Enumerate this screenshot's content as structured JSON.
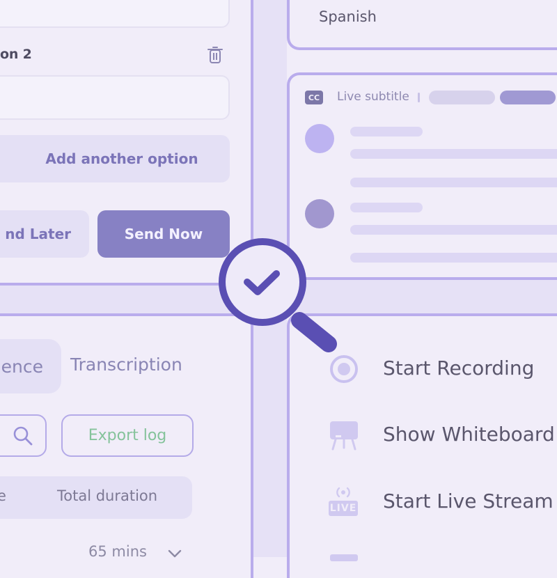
{
  "poll": {
    "option_label": "on 2",
    "add_option_label": "Add another option",
    "send_later_label": "nd Later",
    "send_now_label": "Send Now"
  },
  "language": {
    "value": "Spanish"
  },
  "subtitles": {
    "cc_label": "CC",
    "title": "Live subtitle"
  },
  "transcription": {
    "tab_active_partial": "ence",
    "tab_transcription": "Transcription",
    "export_label": "Export log",
    "column_partial": "e",
    "column_total_duration": "Total duration",
    "row_duration": "65 mins"
  },
  "actions": {
    "start_recording": "Start Recording",
    "show_whiteboard": "Show Whiteboard",
    "start_live_stream": "Start Live Stream",
    "live_badge": "LIVE"
  },
  "colors": {
    "background": "#f1edf9",
    "accent": "#5a4fb3",
    "send_button": "#8781c4",
    "export_text": "#85c39b"
  },
  "icons": [
    "trash-icon",
    "cc-icon",
    "search-icon",
    "record-icon",
    "whiteboard-icon",
    "live-stream-icon",
    "magnifier-check-icon",
    "chevron-down-icon"
  ]
}
